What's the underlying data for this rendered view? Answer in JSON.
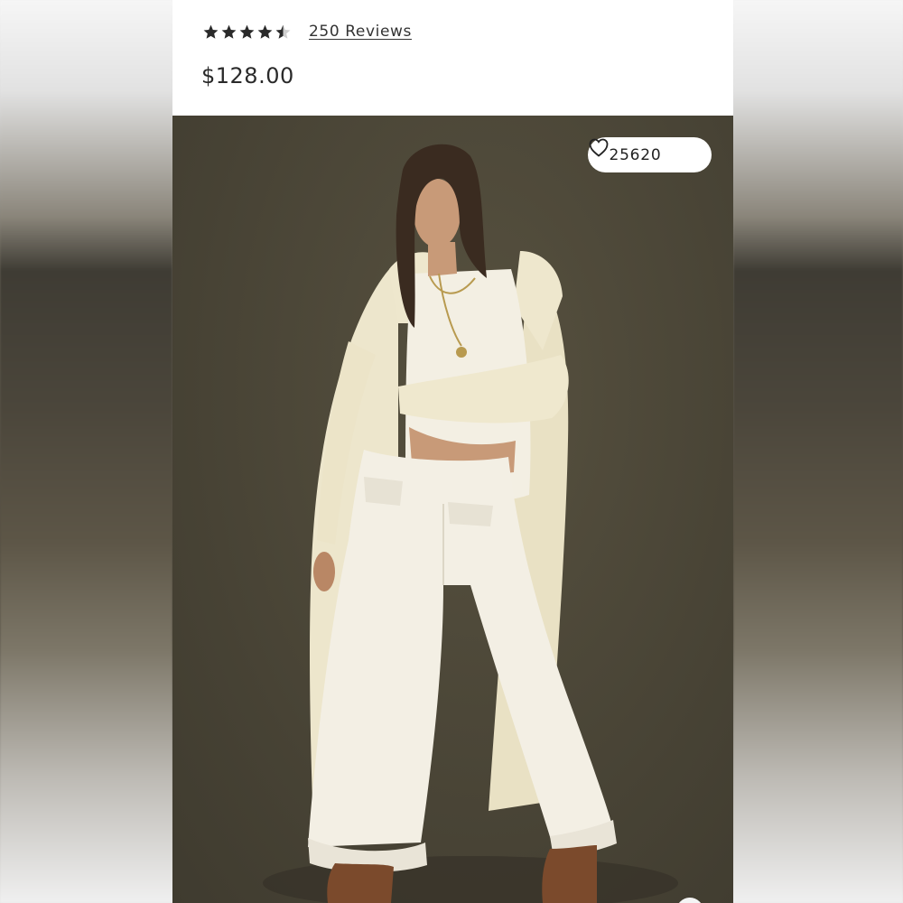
{
  "product": {
    "rating": 4.5,
    "rating_max": 5,
    "reviews_label": "250 Reviews",
    "price": "$128.00"
  },
  "favorites": {
    "count": "25620",
    "icon": "heart-icon"
  },
  "image": {
    "icon": "product-photo"
  },
  "colors": {
    "star": "#2a2a2a",
    "backdrop": "#4c4738",
    "garment": "#f1ecd8"
  }
}
